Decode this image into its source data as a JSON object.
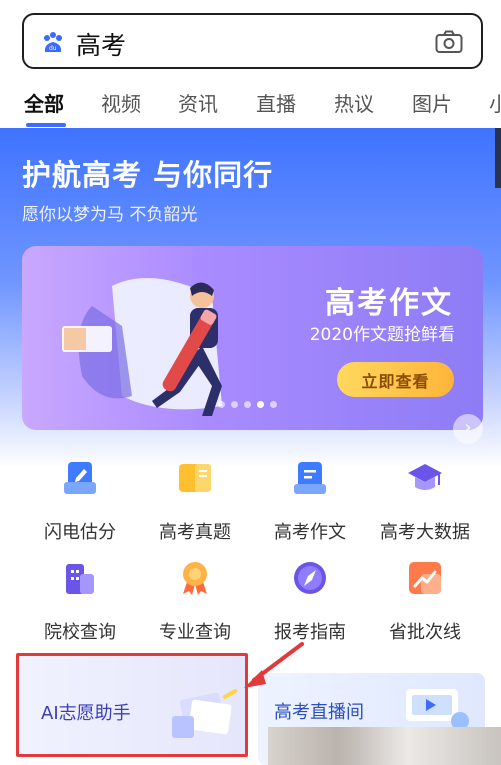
{
  "search": {
    "query": "高考"
  },
  "tabs": [
    "全部",
    "视频",
    "资讯",
    "直播",
    "热议",
    "图片",
    "小"
  ],
  "hero": {
    "title": "护航高考 与你同行",
    "subtitle": "愿你以梦为马 不负韶光",
    "banner": {
      "title": "高考作文",
      "subtitle": "2020作文题抢鲜看",
      "button": "立即查看",
      "dots_total": 5,
      "dots_active_index": 3
    }
  },
  "grid": [
    {
      "label": "闪电估分",
      "icon": "pencil-doc-icon",
      "color": "#3f7bff"
    },
    {
      "label": "高考真题",
      "icon": "exam-paper-icon",
      "color": "#ffbf2e"
    },
    {
      "label": "高考作文",
      "icon": "essay-doc-icon",
      "color": "#3f7bff"
    },
    {
      "label": "高考大数据",
      "icon": "graduation-cap-icon",
      "color": "#6b55e8"
    },
    {
      "label": "院校查询",
      "icon": "school-building-icon",
      "color": "#6b55e8"
    },
    {
      "label": "专业查询",
      "icon": "medal-icon",
      "color": "#ff8a3d"
    },
    {
      "label": "报考指南",
      "icon": "compass-icon",
      "color": "#6b55e8"
    },
    {
      "label": "省批次线",
      "icon": "trend-chart-icon",
      "color": "#ff6a3d"
    }
  ],
  "cards": {
    "ai": "AI志愿助手",
    "live": "高考直播间"
  },
  "colors": {
    "accent": "#3b6cff",
    "highlight_border": "#e23a3a"
  }
}
